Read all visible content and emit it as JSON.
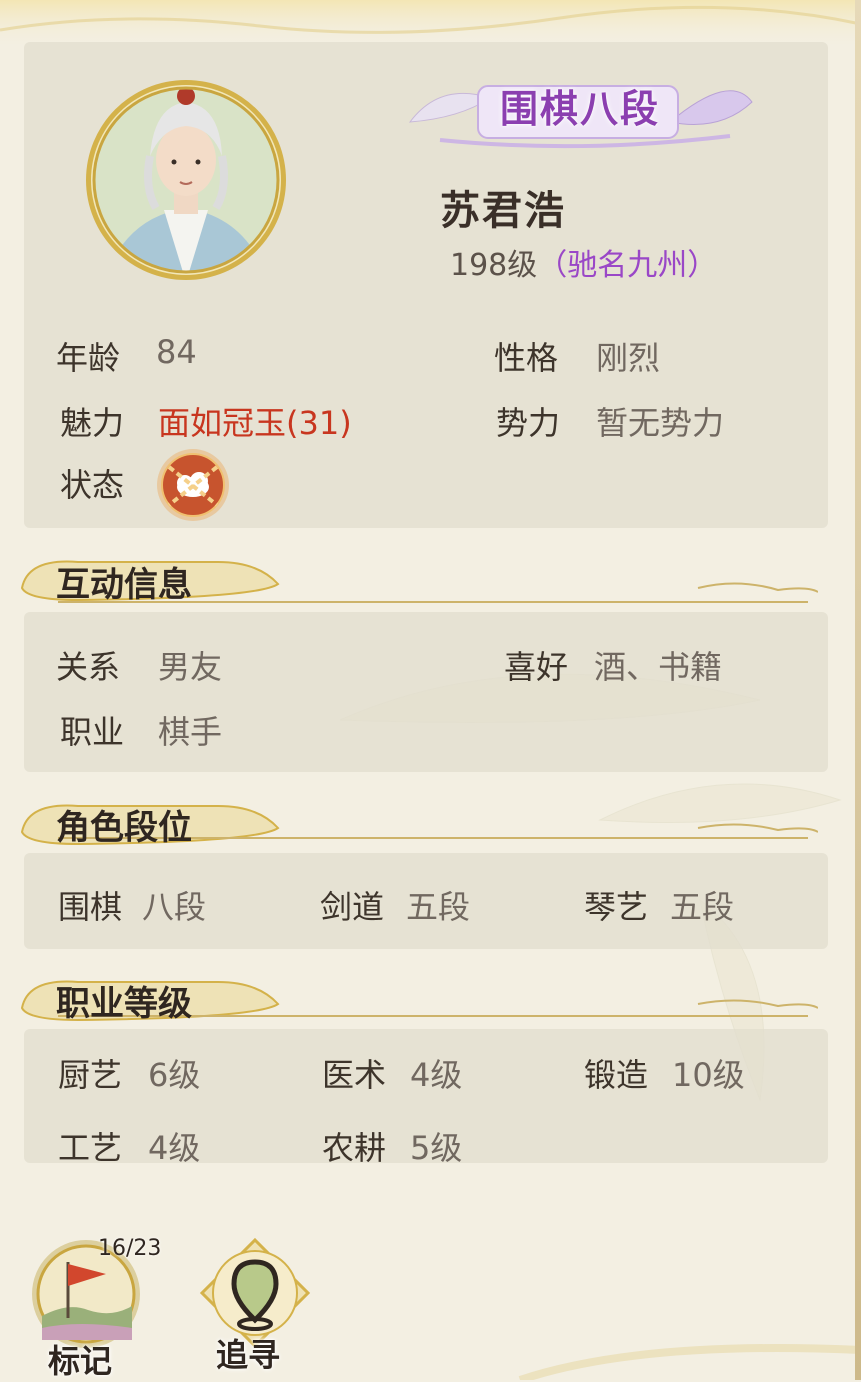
{
  "profile": {
    "title_badge": "围棋八段",
    "name": "苏君浩",
    "level": "198级",
    "fame": "（驰名九州）"
  },
  "attributes": {
    "age_label": "年龄",
    "age_value": "84",
    "personality_label": "性格",
    "personality_value": "刚烈",
    "charm_label": "魅力",
    "charm_value": "面如冠玉(31)",
    "faction_label": "势力",
    "faction_value": "暂无势力",
    "status_label": "状态"
  },
  "interaction": {
    "section_title": "互动信息",
    "relation_label": "关系",
    "relation_value": "男友",
    "hobby_label": "喜好",
    "hobby_value": "酒、书籍",
    "job_label": "职业",
    "job_value": "棋手"
  },
  "ranks": {
    "section_title": "角色段位",
    "items": [
      {
        "label": "围棋",
        "value": "八段"
      },
      {
        "label": "剑道",
        "value": "五段"
      },
      {
        "label": "琴艺",
        "value": "五段"
      }
    ]
  },
  "job_levels": {
    "section_title": "职业等级",
    "items": [
      {
        "label": "厨艺",
        "value": "6级"
      },
      {
        "label": "医术",
        "value": "4级"
      },
      {
        "label": "锻造",
        "value": "10级"
      },
      {
        "label": "工艺",
        "value": "4级"
      },
      {
        "label": "农耕",
        "value": "5级"
      }
    ]
  },
  "actions": {
    "mark_label": "标记",
    "mark_counter": "16/23",
    "track_label": "追寻"
  },
  "colors": {
    "accent_purple": "#8b3fb0",
    "charm_red": "#c8361f",
    "frame_gold": "#d4b24a"
  }
}
